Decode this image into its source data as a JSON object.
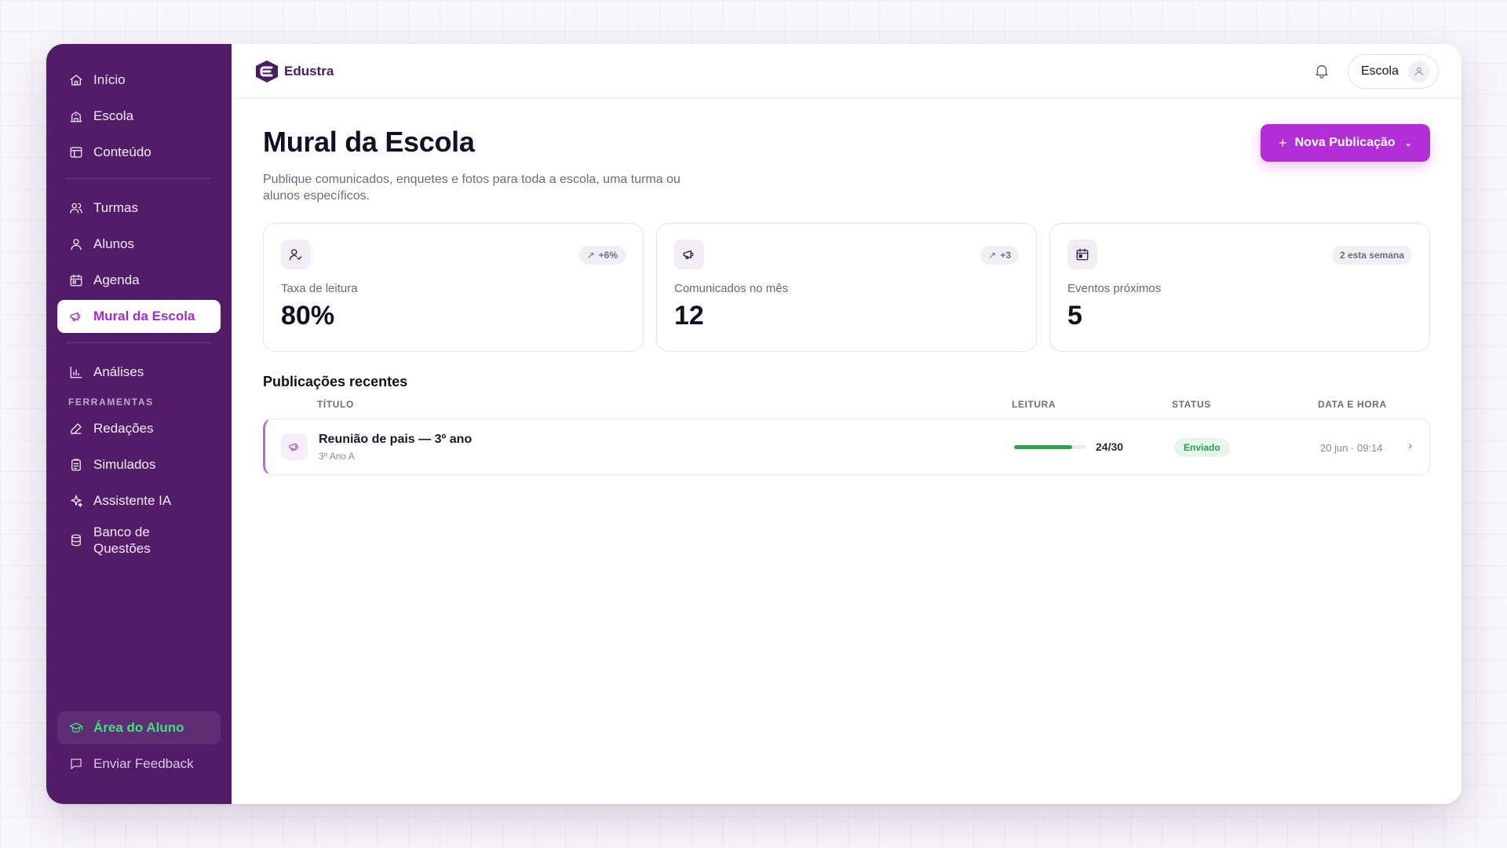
{
  "sidebar": {
    "items_top": [
      {
        "label": "Início",
        "icon": "home-icon"
      },
      {
        "label": "Escola",
        "icon": "school-icon"
      },
      {
        "label": "Conteúdo",
        "icon": "content-icon"
      }
    ],
    "items_mid": [
      {
        "label": "Turmas",
        "icon": "classes-icon"
      },
      {
        "label": "Alunos",
        "icon": "user-icon"
      },
      {
        "label": "Agenda",
        "icon": "calendar-icon"
      },
      {
        "label": "Mural da Escola",
        "icon": "megaphone-icon"
      }
    ],
    "items_analytics": [
      {
        "label": "Análises",
        "icon": "bar-chart-icon"
      }
    ],
    "tools_label": "FERRAMENTAS",
    "items_tools": [
      {
        "label": "Redações",
        "icon": "pencil-icon"
      },
      {
        "label": "Simulados",
        "icon": "clipboard-icon"
      },
      {
        "label": "Assistente IA",
        "icon": "sparkle-icon"
      },
      {
        "label": "Banco de Questões",
        "icon": "database-icon"
      }
    ],
    "student_area": "Área do Aluno",
    "feedback": "Enviar Feedback"
  },
  "header": {
    "brand": "Edustra",
    "account_label": "Escola"
  },
  "page": {
    "title": "Mural da Escola",
    "subtitle": "Publique comunicados, enquetes e fotos para toda a escola, uma turma ou alunos específicos.",
    "new_button": "Nova Publicação"
  },
  "stats": [
    {
      "label": "Taxa de leitura",
      "value": "80%",
      "badge": "+6%",
      "icon": "user-check-icon"
    },
    {
      "label": "Comunicados no mês",
      "value": "12",
      "badge": "+3",
      "icon": "megaphone-icon"
    },
    {
      "label": "Eventos próximos",
      "value": "5",
      "badge": "2 esta semana",
      "icon": "calendar-icon"
    }
  ],
  "recent": {
    "title": "Publicações recentes",
    "columns": {
      "title": "TÍTULO",
      "read": "LEITURA",
      "status": "STATUS",
      "date": "DATA E HORA"
    },
    "rows": [
      {
        "title": "Reunião de pais — 3º ano",
        "audience": "3º Ano A",
        "read": "24/30",
        "read_fraction": 0.8,
        "status": "Enviado",
        "date": "20 jun · 09:14"
      }
    ]
  },
  "colors": {
    "sidebar": "#521c69",
    "accent": "#b22fd8",
    "success": "#1faa4a",
    "student_green": "#3fe07a"
  }
}
